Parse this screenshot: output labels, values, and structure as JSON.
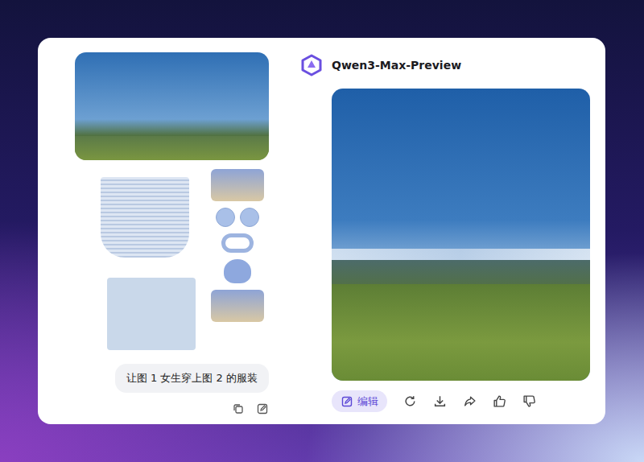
{
  "conversation": {
    "user": {
      "attachments": [
        {
          "kind": "photo"
        },
        {
          "kind": "collage"
        }
      ],
      "message": "让图 1 女生穿上图 2 的服装",
      "message_actions": [
        {
          "kind": "copy"
        },
        {
          "kind": "edit"
        }
      ]
    },
    "assistant": {
      "model": "Qwen3-Max-Preview",
      "result": {
        "kind": "photo"
      },
      "actions": [
        {
          "kind": "edit",
          "label": "编辑"
        },
        {
          "kind": "regenerate"
        },
        {
          "kind": "download"
        },
        {
          "kind": "share"
        },
        {
          "kind": "like"
        },
        {
          "kind": "dislike"
        }
      ]
    }
  }
}
